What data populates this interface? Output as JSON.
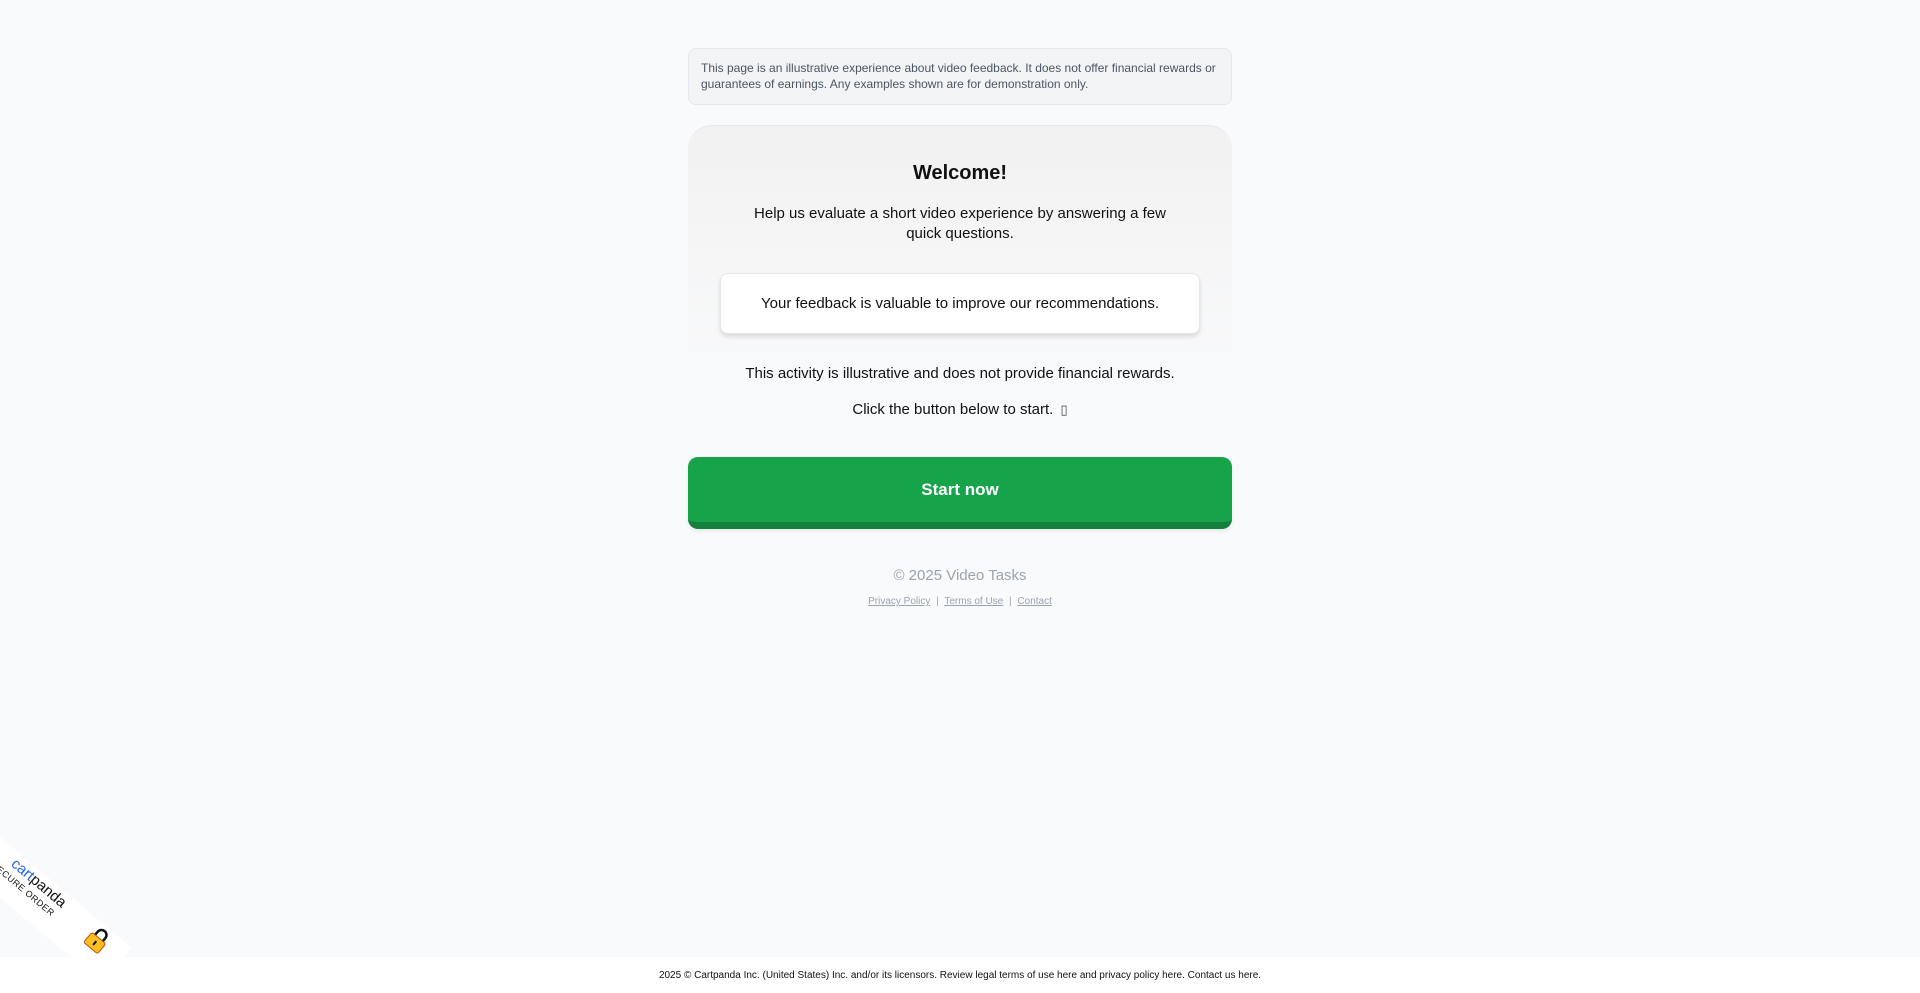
{
  "disclaimer": "This page is an illustrative experience about video feedback. It does not offer financial rewards or guarantees of earnings. Any examples shown are for demonstration only.",
  "card": {
    "title": "Welcome!",
    "subtitle": "Help us evaluate a short video experience by answering a few quick questions.",
    "notice": "Your feedback is valuable to improve our recommendations.",
    "info": "This activity is illustrative and does not provide financial rewards.",
    "cta_text": "Click the button below to start.",
    "cta_glyph": "▯"
  },
  "start_button": {
    "label": "Start now"
  },
  "copyright": "© 2025 Video Tasks",
  "links": {
    "privacy": "Privacy Policy",
    "separator": "|",
    "terms": "Terms of Use",
    "contact": "Contact"
  },
  "badge": {
    "brand_cart": "cart",
    "brand_panda": "panda",
    "label": "SECURE ORDER",
    "lock_icon": "lock-icon"
  },
  "footer": {
    "text": "2025 © Cartpanda Inc. (United States) Inc. and/or its licensors. Review legal terms of use here and privacy policy here. Contact us here."
  },
  "colors": {
    "background": "#f8fafc",
    "button": "#16a34a",
    "button_shadow": "#15803d",
    "brand_blue": "#2563eb",
    "lock_yellow": "#fbbf24"
  }
}
